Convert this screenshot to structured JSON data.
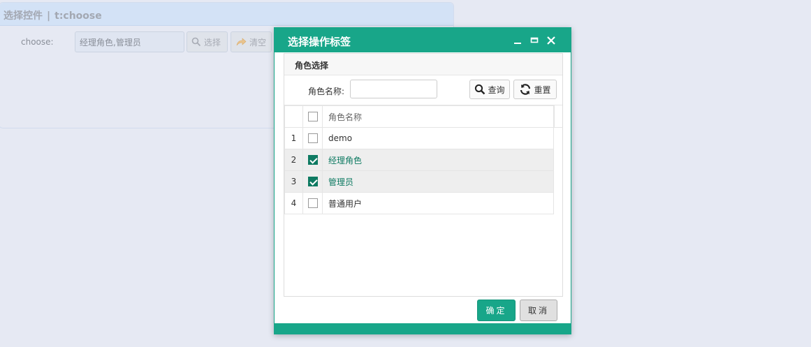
{
  "background": {
    "panel_title": "选择控件",
    "panel_separator": "|",
    "panel_subtitle": "t:choose",
    "field_label": "choose:",
    "field_value": "经理角色,管理员",
    "select_button": "选择",
    "clear_button": "清空"
  },
  "dialog": {
    "title": "选择操作标签",
    "section_title": "角色选择",
    "search_label": "角色名称:",
    "search_value": "",
    "query_button": "查询",
    "reset_button": "重置",
    "table": {
      "header": "角色名称",
      "rows": [
        {
          "num": "1",
          "name": "demo",
          "checked": false
        },
        {
          "num": "2",
          "name": "经理角色",
          "checked": true
        },
        {
          "num": "3",
          "name": "管理员",
          "checked": true
        },
        {
          "num": "4",
          "name": "普通用户",
          "checked": false
        }
      ]
    },
    "ok_button": "确定",
    "cancel_button": "取消"
  },
  "colors": {
    "accent": "#18a689",
    "selected_text": "#0e7a62"
  }
}
